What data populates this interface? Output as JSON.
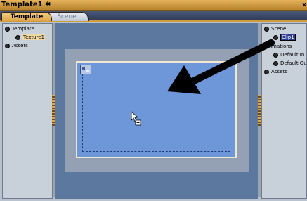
{
  "window": {
    "title": "Template1",
    "close_glyph": "x"
  },
  "tabs": [
    {
      "label": "Template",
      "active": true
    },
    {
      "label": "Scene",
      "active": false
    }
  ],
  "left_tree": [
    {
      "label": "Template",
      "depth": 0
    },
    {
      "label": "Texture1",
      "depth": 1
    },
    {
      "label": "Assets",
      "depth": 0
    }
  ],
  "right_tree": {
    "scene": "Scene",
    "clip": "Clip1",
    "animations": "Animations",
    "default_in": "Default In",
    "default_out": "Default Out",
    "assets": "Assets"
  },
  "colors": {
    "title_bar": "#d29b3a",
    "tab_bar": "#3a4868",
    "stage": "#5d789e",
    "canvas": "#6d97d8",
    "annotation_arrow": "#000000"
  },
  "icons": [
    "asterisk-icon",
    "close-icon",
    "bullet-icon",
    "image-thumbnail-icon",
    "pointer-cursor-icon",
    "annotation-arrow-icon"
  ]
}
